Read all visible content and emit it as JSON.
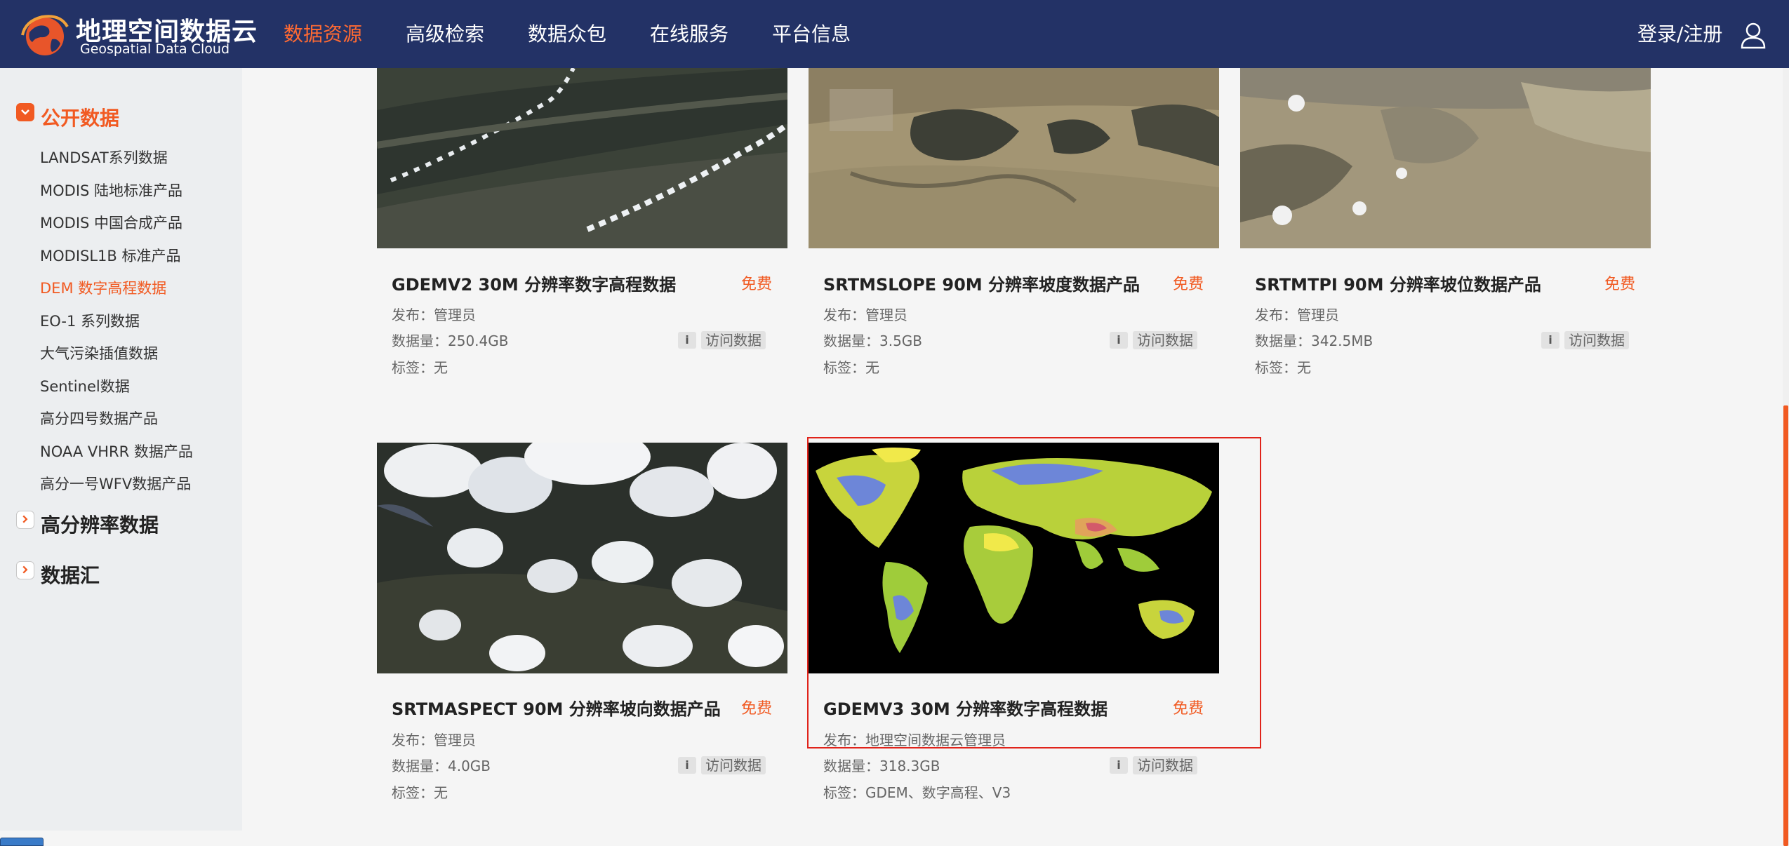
{
  "header": {
    "logo_cn": "地理空间数据云",
    "logo_en": "Geospatial Data Cloud",
    "nav": [
      "数据资源",
      "高级检索",
      "数据众包",
      "在线服务",
      "平台信息"
    ],
    "login": "登录/注册",
    "colors": {
      "bg": "#233266",
      "accent": "#ff6a33"
    }
  },
  "sidebar": {
    "sections": [
      {
        "title": "公开数据",
        "state": "expanded"
      },
      {
        "title": "高分辨率数据",
        "state": "collapsed"
      },
      {
        "title": "数据汇",
        "state": "collapsed"
      }
    ],
    "items": [
      "LANDSAT系列数据",
      "MODIS 陆地标准产品",
      "MODIS 中国合成产品",
      "MODISL1B 标准产品",
      "DEM 数字高程数据",
      "EO-1 系列数据",
      "大气污染插值数据",
      "Sentinel数据",
      "高分四号数据产品",
      "NOAA VHRR 数据产品",
      "高分一号WFV数据产品"
    ],
    "active_item": "DEM 数字高程数据"
  },
  "cards": [
    {
      "title": "GDEMV2 30M 分辨率数字高程数据",
      "free": "免费",
      "publisher": "发布：管理员",
      "size": "数据量：250.4GB",
      "tags": "标签：无",
      "visit": "访问数据",
      "info": "i"
    },
    {
      "title": "SRTMSLOPE 90M 分辨率坡度数据产品",
      "free": "免费",
      "publisher": "发布：管理员",
      "size": "数据量：3.5GB",
      "tags": "标签：无",
      "visit": "访问数据",
      "info": "i"
    },
    {
      "title": "SRTMTPI 90M 分辨率坡位数据产品",
      "free": "免费",
      "publisher": "发布：管理员",
      "size": "数据量：342.5MB",
      "tags": "标签：无",
      "visit": "访问数据",
      "info": "i"
    },
    {
      "title": "SRTMASPECT 90M 分辨率坡向数据产品",
      "free": "免费",
      "publisher": "发布：管理员",
      "size": "数据量：4.0GB",
      "tags": "标签：无",
      "visit": "访问数据",
      "info": "i"
    },
    {
      "title": "GDEMV3 30M 分辨率数字高程数据",
      "free": "免费",
      "publisher": "发布：地理空间数据云管理员",
      "size": "数据量：318.3GB",
      "tags": "标签：GDEM、数字高程、V3",
      "visit": "访问数据",
      "info": "i"
    }
  ],
  "colors": {
    "accent": "#f15a22",
    "highlight": "#e0231a"
  }
}
